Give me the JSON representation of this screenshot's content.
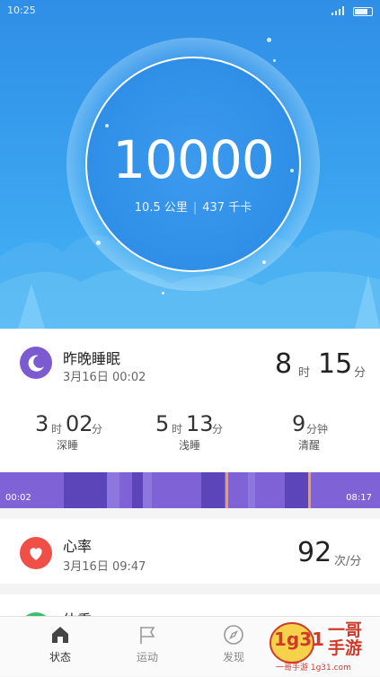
{
  "status_bar": {
    "time": "10:25"
  },
  "hero": {
    "steps": "10000",
    "distance": "10.5 公里",
    "separator": "|",
    "calories": "437 千卡"
  },
  "sleep": {
    "title": "昨晚睡眠",
    "date": "3月16日 00:02",
    "total_hours": "8",
    "hour_unit": "时",
    "total_minutes": "15",
    "minute_unit": "分",
    "stats": [
      {
        "h": "3",
        "h_unit": "时",
        "m": "02",
        "m_unit": "分",
        "label": "深睡"
      },
      {
        "h": "5",
        "h_unit": "时",
        "m": "13",
        "m_unit": "分",
        "label": "浅睡"
      },
      {
        "m": "9",
        "m_unit": "分钟",
        "label": "清醒"
      }
    ],
    "timeline_start": "00:02",
    "timeline_end": "08:17"
  },
  "heart_rate": {
    "title": "心率",
    "date": "3月16日 09:47",
    "value": "92",
    "unit": "次/分"
  },
  "weight": {
    "title": "体重"
  },
  "tabs": [
    {
      "label": "状态",
      "icon": "home-icon",
      "active": true
    },
    {
      "label": "运动",
      "icon": "flag-icon",
      "active": false
    },
    {
      "label": "发现",
      "icon": "compass-icon",
      "active": false
    }
  ],
  "watermark": {
    "brand": "1g31",
    "text": "一哥手游",
    "site": "一哥手游 1g31.com"
  },
  "colors": {
    "primary": "#2f8ee6",
    "sleep": "#7c5bd0",
    "heart": "#ef4f47",
    "weight": "#3cbf6a",
    "wake": "#f0a040"
  }
}
